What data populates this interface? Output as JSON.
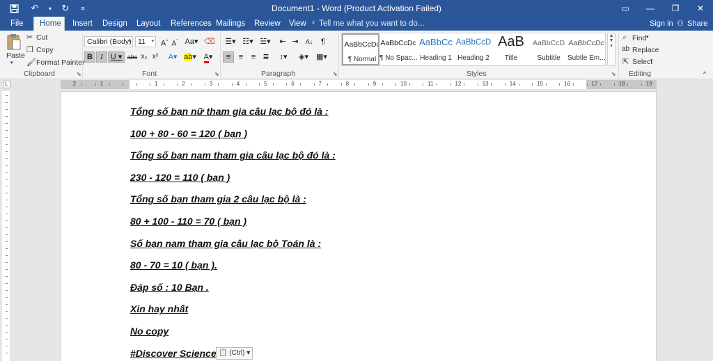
{
  "window": {
    "title": "Document1 - Word (Product Activation Failed)"
  },
  "tabs": [
    "File",
    "Home",
    "Insert",
    "Design",
    "Layout",
    "References",
    "Mailings",
    "Review",
    "View"
  ],
  "tell_me": "Tell me what you want to do...",
  "account": {
    "sign_in": "Sign in",
    "share": "Share"
  },
  "clipboard": {
    "paste": "Paste",
    "cut": "Cut",
    "copy": "Copy",
    "format_painter": "Format Painter",
    "label": "Clipboard"
  },
  "font": {
    "family": "Calibri (Body)",
    "size": "11",
    "label": "Font"
  },
  "paragraph": {
    "label": "Paragraph"
  },
  "styles": {
    "label": "Styles",
    "items": [
      {
        "preview": "AaBbCcDc",
        "name": "¶ Normal"
      },
      {
        "preview": "AaBbCcDc",
        "name": "¶ No Spac..."
      },
      {
        "preview": "AaBbCc",
        "name": "Heading 1"
      },
      {
        "preview": "AaBbCcD",
        "name": "Heading 2"
      },
      {
        "preview": "AaB",
        "name": "Title"
      },
      {
        "preview": "AaBbCcD",
        "name": "Subtitle"
      },
      {
        "preview": "AaBbCcDc",
        "name": "Subtle Em..."
      }
    ]
  },
  "editing": {
    "find": "Find",
    "replace": "Replace",
    "select": "Select",
    "label": "Editing"
  },
  "document": {
    "lines": [
      "Tổng số bạn nữ tham gia câu lạc bộ đó là :",
      "100 + 80 - 60 = 120 ( bạn )",
      "Tổng số bạn nam tham gia câu lạc bộ đó là :",
      "230 - 120 = 110 ( bạn )",
      "Tổng số bạn tham gia 2 câu lạc bộ là :",
      "80 + 100 - 110 = 70 ( bạn )",
      "Số bạn nam tham gia câu lạc bộ Toán là :",
      "80 - 70 = 10 ( bạn ).",
      "Đáp số : 10 Bạn .",
      "Xin hay nhất",
      "No copy",
      "#Discover Science ."
    ],
    "paste_options": "(Ctrl)"
  },
  "ruler": {
    "numbers": [
      "2",
      "1",
      "1",
      "2",
      "3",
      "4",
      "5",
      "6",
      "7",
      "8",
      "9",
      "10",
      "11",
      "12",
      "13",
      "14",
      "15",
      "16",
      "17",
      "18",
      "19"
    ]
  }
}
